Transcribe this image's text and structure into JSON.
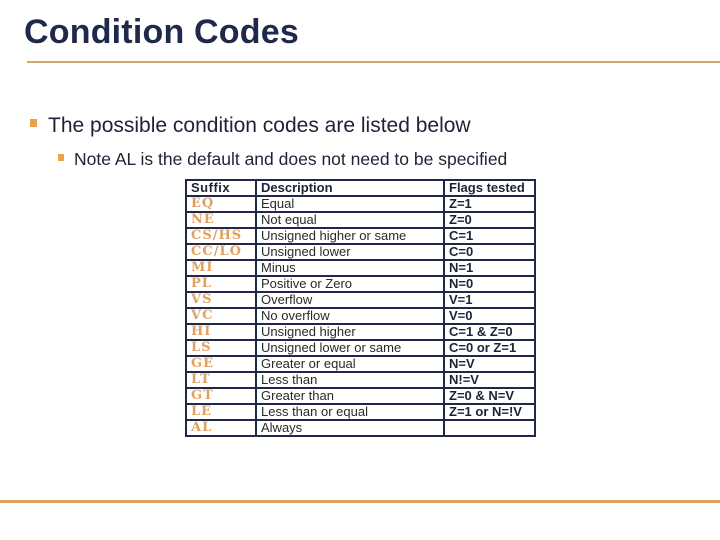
{
  "slide": {
    "title": "Condition Codes",
    "accent_color": "#E0A060",
    "title_color": "#1F2A4A"
  },
  "bullets": [
    {
      "level": 1,
      "text": "The possible condition codes are listed below"
    },
    {
      "level": 2,
      "text": "Note AL is the default and does not need to be specified"
    }
  ],
  "table": {
    "headers": {
      "suffix": "Suffix",
      "description": "Description",
      "flags": "Flags tested"
    },
    "rows": [
      {
        "suffix": "EQ",
        "description": "Equal",
        "flags": "Z=1"
      },
      {
        "suffix": "NE",
        "description": "Not equal",
        "flags": "Z=0"
      },
      {
        "suffix": "CS/HS",
        "description": "Unsigned higher or same",
        "flags": "C=1"
      },
      {
        "suffix": "CC/LO",
        "description": "Unsigned lower",
        "flags": "C=0"
      },
      {
        "suffix": "MI",
        "description": "Minus",
        "flags": "N=1"
      },
      {
        "suffix": "PL",
        "description": "Positive or Zero",
        "flags": "N=0"
      },
      {
        "suffix": "VS",
        "description": "Overflow",
        "flags": "V=1"
      },
      {
        "suffix": "VC",
        "description": "No overflow",
        "flags": "V=0"
      },
      {
        "suffix": "HI",
        "description": "Unsigned higher",
        "flags": "C=1  & Z=0"
      },
      {
        "suffix": "LS",
        "description": "Unsigned lower or same",
        "flags": "C=0 or Z=1"
      },
      {
        "suffix": "GE",
        "description": "Greater or equal",
        "flags": "N=V"
      },
      {
        "suffix": "LT",
        "description": "Less than",
        "flags": "N!=V"
      },
      {
        "suffix": "GT",
        "description": "Greater than",
        "flags": "Z=0 & N=V"
      },
      {
        "suffix": "LE",
        "description": "Less than or equal",
        "flags": "Z=1 or N=!V"
      },
      {
        "suffix": "AL",
        "description": "Always",
        "flags": ""
      }
    ]
  }
}
